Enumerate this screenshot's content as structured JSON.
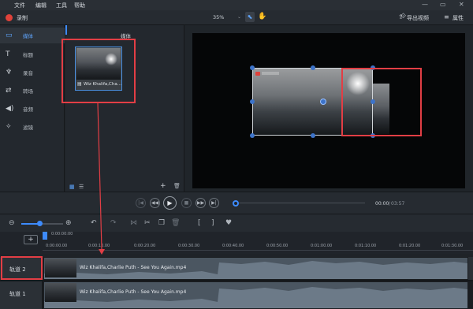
{
  "menu": {
    "items": [
      "文件",
      "编辑",
      "工具",
      "帮助"
    ]
  },
  "toolbar": {
    "record_label": "录制",
    "zoom_value": "35%",
    "export_label": "导出视频",
    "properties_label": "属性"
  },
  "sidebar": {
    "items": [
      {
        "icon": "media-icon",
        "label": "媒体"
      },
      {
        "icon": "text-icon",
        "label": "标题"
      },
      {
        "icon": "microphone-icon",
        "label": "录音"
      },
      {
        "icon": "transition-icon",
        "label": "转场"
      },
      {
        "icon": "audio-icon",
        "label": "音频"
      },
      {
        "icon": "filter-icon",
        "label": "滤镜"
      }
    ]
  },
  "media": {
    "header": "媒体",
    "item_name": "Wiz Khalifa,Cha...",
    "plus": "+"
  },
  "player": {
    "time_current": "00:00",
    "time_total": "03:57"
  },
  "ruler": {
    "start_label": "0:00:00:00",
    "ticks": [
      "0:00:00.00",
      "0:00:10.00",
      "0:00:20.00",
      "0:00:30.00",
      "0:00:40.00",
      "0:00:50.00",
      "0:01:00.00",
      "0:01:10.00",
      "0:01:20.00",
      "0:01:30.00"
    ]
  },
  "tracks": [
    {
      "label": "轨道 2",
      "clip": "Wiz Khalifa,Charlie Puth - See You Again.mp4"
    },
    {
      "label": "轨道 1",
      "clip": "Wiz Khalifa,Charlie Puth - See You Again.mp4"
    }
  ],
  "colors": {
    "accent": "#3d8bfd",
    "record": "#e0423a",
    "highlight": "#e23e45"
  }
}
